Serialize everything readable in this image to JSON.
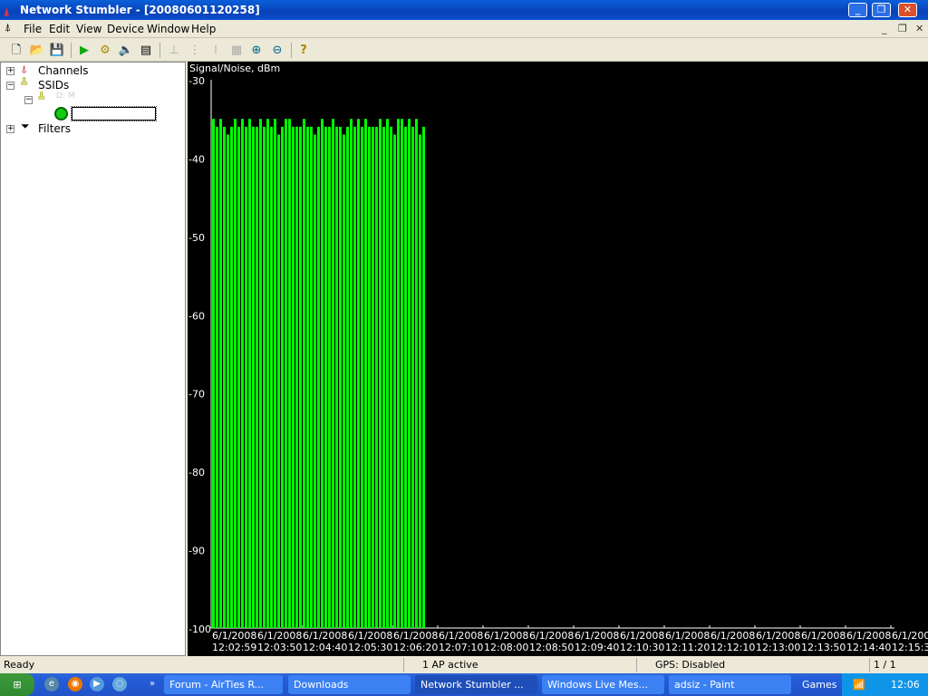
{
  "window": {
    "title": "Network Stumbler - [20080601120258]"
  },
  "menu": [
    "File",
    "Edit",
    "View",
    "Device",
    "Window",
    "Help"
  ],
  "toolbar": [
    "new-icon",
    "open-icon",
    "save-icon",
    "play-icon",
    "gear-icon",
    "speaker-icon",
    "properties-icon",
    "tree-icon",
    "list-icon",
    "list2-icon",
    "grid-icon",
    "zoom-in-icon",
    "zoom-out-icon",
    "help-icon"
  ],
  "tree": {
    "channels": "Channels",
    "ssids": "SSIDs",
    "ssid_child": "D: M",
    "filters": "Filters",
    "edit_value": ""
  },
  "chart_data": {
    "type": "bar",
    "title": "Signal/Noise, dBm",
    "ylim": [
      -100,
      -30
    ],
    "yticks": [
      "-30",
      "-40",
      "-50",
      "-60",
      "-70",
      "-80",
      "-90",
      "-100"
    ],
    "xticks": [
      [
        "6/1/2008",
        "12:02:59"
      ],
      [
        "6/1/2008",
        "12:03:50"
      ],
      [
        "6/1/2008",
        "12:04:40"
      ],
      [
        "6/1/2008",
        "12:05:30"
      ],
      [
        "6/1/2008",
        "12:06:20"
      ],
      [
        "6/1/2008",
        "12:07:10"
      ],
      [
        "6/1/2008",
        "12:08:00"
      ],
      [
        "6/1/2008",
        "12:08:50"
      ],
      [
        "6/1/2008",
        "12:09:40"
      ],
      [
        "6/1/2008",
        "12:10:30"
      ],
      [
        "6/1/2008",
        "12:11:20"
      ],
      [
        "6/1/2008",
        "12:12:10"
      ],
      [
        "6/1/2008",
        "12:13:00"
      ],
      [
        "6/1/2008",
        "12:13:50"
      ],
      [
        "6/1/2008",
        "12:14:40"
      ],
      [
        "6/1/2008",
        "12:15:3"
      ]
    ],
    "series_start": "12:02:59",
    "sample_seconds": 4,
    "values": [
      -35,
      -36,
      -35,
      -36,
      -37,
      -36,
      -35,
      -36,
      -35,
      -36,
      -35,
      -36,
      -36,
      -35,
      -36,
      -35,
      -36,
      -35,
      -37,
      -36,
      -35,
      -35,
      -36,
      -36,
      -36,
      -35,
      -36,
      -36,
      -37,
      -36,
      -35,
      -36,
      -36,
      -35,
      -36,
      -36,
      -37,
      -36,
      -35,
      -36,
      -35,
      -36,
      -35,
      -36,
      -36,
      -36,
      -35,
      -36,
      -35,
      -36,
      -37,
      -35,
      -35,
      -36,
      -35,
      -36,
      -35,
      -37,
      -36
    ],
    "bar_color": "#00ff00"
  },
  "status": {
    "ready": "Ready",
    "ap": "1 AP active",
    "gps": "GPS: Disabled",
    "page": "1 / 1"
  },
  "taskbar": {
    "tasks": [
      "Forum - AirTies R...",
      "Downloads",
      "Network Stumbler ...",
      "Windows Live Mes...",
      "adsiz - Paint"
    ],
    "games": "Games",
    "clock": "12:06"
  }
}
